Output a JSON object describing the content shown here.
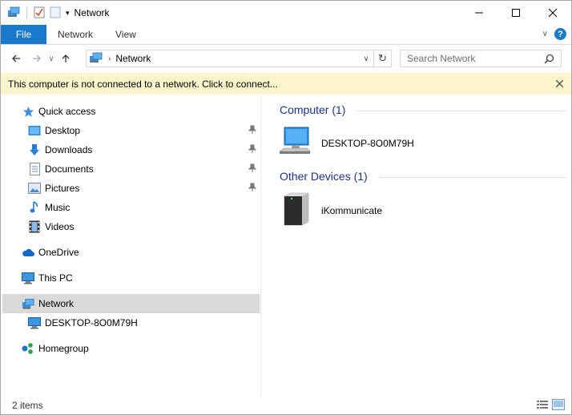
{
  "window": {
    "title": "Network"
  },
  "ribbon": {
    "tabs": [
      "File",
      "Network",
      "View"
    ],
    "help_label": "?"
  },
  "address": {
    "location": "Network",
    "search_placeholder": "Search Network"
  },
  "infobar": {
    "message": "This computer is not connected to a network. Click to connect..."
  },
  "nav": {
    "items": [
      {
        "label": "Quick access",
        "icon": "star-icon",
        "pinned": false
      },
      {
        "label": "Desktop",
        "icon": "desktop-folder-icon",
        "pinned": true
      },
      {
        "label": "Downloads",
        "icon": "download-arrow-icon",
        "pinned": true
      },
      {
        "label": "Documents",
        "icon": "documents-icon",
        "pinned": true
      },
      {
        "label": "Pictures",
        "icon": "pictures-icon",
        "pinned": true
      },
      {
        "label": "Music",
        "icon": "music-note-icon",
        "pinned": false
      },
      {
        "label": "Videos",
        "icon": "film-icon",
        "pinned": false
      },
      {
        "label": "OneDrive",
        "icon": "cloud-icon",
        "pinned": false
      },
      {
        "label": "This PC",
        "icon": "monitor-icon",
        "pinned": false
      },
      {
        "label": "Network",
        "icon": "network-icon",
        "pinned": false,
        "selected": true
      },
      {
        "label": "DESKTOP-8O0M79H",
        "icon": "monitor-icon",
        "pinned": false
      },
      {
        "label": "Homegroup",
        "icon": "homegroup-icon",
        "pinned": false
      }
    ]
  },
  "content": {
    "groups": [
      {
        "name": "Computer (1)",
        "items": [
          "DESKTOP-8O0M79H"
        ]
      },
      {
        "name": "Other Devices (1)",
        "items": [
          "iKommunicate"
        ]
      }
    ]
  },
  "status": {
    "item_count": "2 items"
  },
  "colors": {
    "accent": "#1979ca",
    "group_header": "#1e3287",
    "infobar_bg": "#fdf6cc",
    "selection": "#d9d9d9"
  }
}
